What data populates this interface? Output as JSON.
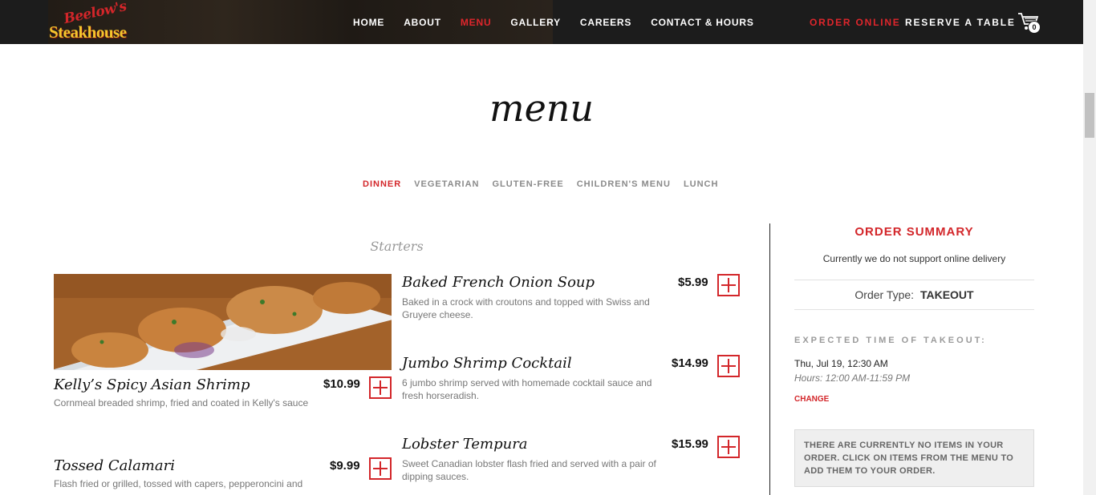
{
  "header": {
    "logo_script": "Beelow's",
    "logo_word": "Steakhouse",
    "nav": [
      "HOME",
      "ABOUT",
      "MENU",
      "GALLERY",
      "CAREERS",
      "CONTACT & HOURS"
    ],
    "active_nav": "MENU",
    "order_online": "ORDER ONLINE",
    "reserve": "RESERVE A TABLE",
    "cart_count": "0",
    "cart_icon": "cart-icon"
  },
  "page_title": "menu",
  "tabs": [
    "DINNER",
    "VEGETARIAN",
    "GLUTEN-FREE",
    "CHILDREN'S MENU",
    "LUNCH"
  ],
  "active_tab": "DINNER",
  "section": "Starters",
  "menu_items": [
    {
      "name": "Kelly’s Spicy Asian Shrimp",
      "price": "$10.99",
      "desc": "Cornmeal breaded shrimp, fried and coated in Kelly's sauce"
    },
    {
      "name": "Tossed Calamari",
      "price": "$9.99",
      "desc": "Flash fried or grilled, tossed with capers, pepperoncini and"
    },
    {
      "name": "Baked French Onion Soup",
      "price": "$5.99",
      "desc": "Baked in a crock with croutons and topped with Swiss and Gruyere cheese."
    },
    {
      "name": "Jumbo Shrimp Cocktail",
      "price": "$14.99",
      "desc": "6 jumbo shrimp served with homemade cocktail sauce and fresh horseradish."
    },
    {
      "name": "Lobster Tempura",
      "price": "$15.99",
      "desc": "Sweet Canadian lobster flash fried and served with a pair of dipping sauces."
    }
  ],
  "summary": {
    "title": "ORDER SUMMARY",
    "note": "Currently we do not support online delivery",
    "order_type_label": "Order Type:",
    "order_type": "TAKEOUT",
    "expected_label": "EXPECTED TIME OF TAKEOUT:",
    "expected_date": "Thu, Jul 19, 12:30 AM",
    "hours": "Hours: 12:00 AM-11:59 PM",
    "change": "CHANGE",
    "empty_message": "THERE ARE CURRENTLY NO ITEMS IN YOUR ORDER. CLICK ON ITEMS FROM THE MENU TO ADD THEM TO YOUR ORDER."
  },
  "colors": {
    "accent": "#d3262a",
    "header_bg": "#1c1c1c"
  }
}
